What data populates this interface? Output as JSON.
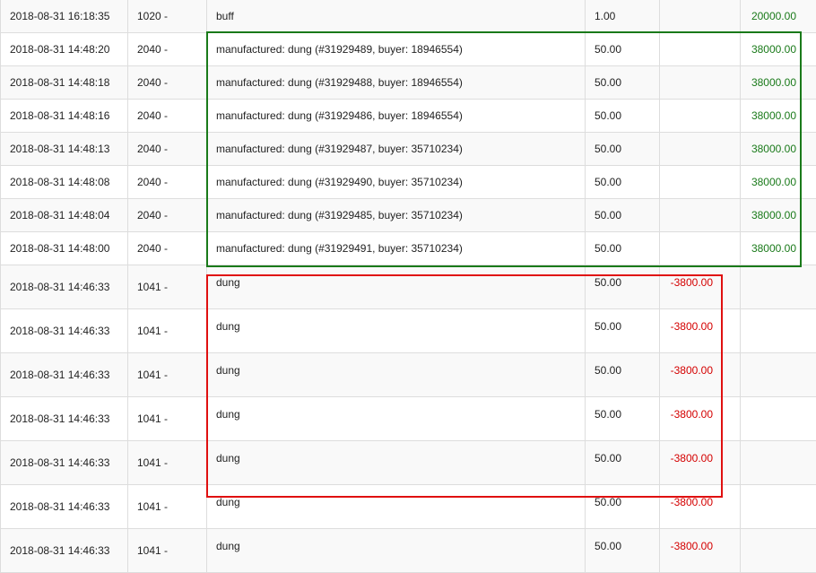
{
  "rows": [
    {
      "date": "2018-08-31 16:18:35",
      "code": "1020 -",
      "desc": "buff",
      "qty": "1.00",
      "debit": "",
      "credit": "20000.00"
    },
    {
      "date": "2018-08-31 14:48:20",
      "code": "2040 -",
      "desc": "manufactured: dung (#31929489, buyer: 18946554)",
      "qty": "50.00",
      "debit": "",
      "credit": "38000.00"
    },
    {
      "date": "2018-08-31 14:48:18",
      "code": "2040 -",
      "desc": "manufactured: dung (#31929488, buyer: 18946554)",
      "qty": "50.00",
      "debit": "",
      "credit": "38000.00"
    },
    {
      "date": "2018-08-31 14:48:16",
      "code": "2040 -",
      "desc": "manufactured: dung (#31929486, buyer: 18946554)",
      "qty": "50.00",
      "debit": "",
      "credit": "38000.00"
    },
    {
      "date": "2018-08-31 14:48:13",
      "code": "2040 -",
      "desc": "manufactured: dung (#31929487, buyer: 35710234)",
      "qty": "50.00",
      "debit": "",
      "credit": "38000.00"
    },
    {
      "date": "2018-08-31 14:48:08",
      "code": "2040 -",
      "desc": "manufactured: dung (#31929490, buyer: 35710234)",
      "qty": "50.00",
      "debit": "",
      "credit": "38000.00"
    },
    {
      "date": "2018-08-31 14:48:04",
      "code": "2040 -",
      "desc": "manufactured: dung (#31929485, buyer: 35710234)",
      "qty": "50.00",
      "debit": "",
      "credit": "38000.00"
    },
    {
      "date": "2018-08-31 14:48:00",
      "code": "2040 -",
      "desc": "manufactured: dung (#31929491, buyer: 35710234)",
      "qty": "50.00",
      "debit": "",
      "credit": "38000.00"
    },
    {
      "date": "2018-08-31 14:46:33",
      "code": "1041 -",
      "desc": "dung",
      "qty": "50.00",
      "debit": "-3800.00",
      "credit": ""
    },
    {
      "date": "2018-08-31 14:46:33",
      "code": "1041 -",
      "desc": "dung",
      "qty": "50.00",
      "debit": "-3800.00",
      "credit": ""
    },
    {
      "date": "2018-08-31 14:46:33",
      "code": "1041 -",
      "desc": "dung",
      "qty": "50.00",
      "debit": "-3800.00",
      "credit": ""
    },
    {
      "date": "2018-08-31 14:46:33",
      "code": "1041 -",
      "desc": "dung",
      "qty": "50.00",
      "debit": "-3800.00",
      "credit": ""
    },
    {
      "date": "2018-08-31 14:46:33",
      "code": "1041 -",
      "desc": "dung",
      "qty": "50.00",
      "debit": "-3800.00",
      "credit": ""
    },
    {
      "date": "2018-08-31 14:46:33",
      "code": "1041 -",
      "desc": "dung",
      "qty": "50.00",
      "debit": "-3800.00",
      "credit": ""
    },
    {
      "date": "2018-08-31 14:46:33",
      "code": "1041 -",
      "desc": "dung",
      "qty": "50.00",
      "debit": "-3800.00",
      "credit": ""
    }
  ],
  "colors": {
    "credit_text": "#1a7a1a",
    "debit_text": "#d40000",
    "highlight_green": "#1a7a1a",
    "highlight_red": "#e01010"
  }
}
